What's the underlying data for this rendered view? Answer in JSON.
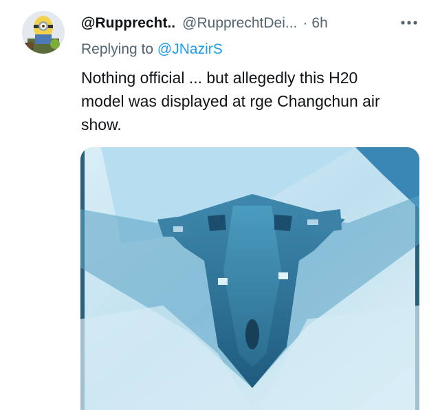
{
  "tweet": {
    "avatar_icon": "minion-avatar-icon",
    "display_name": "@Rupprecht..",
    "handle": "@RupprechtDei...",
    "separator": "·",
    "time": "6h",
    "more_icon": "more-horizontal-icon",
    "reply_prefix": "Replying to",
    "reply_mention": "@JNazirS",
    "text": "Nothing official ... but allegedly this H20\nmodel was  displayed at rge  Changchun air\nshow.",
    "media_description": "stealth-bomber-model-photo"
  },
  "colors": {
    "primary_text": "#0f1419",
    "secondary_text": "#536471",
    "link": "#1d9bf0"
  }
}
